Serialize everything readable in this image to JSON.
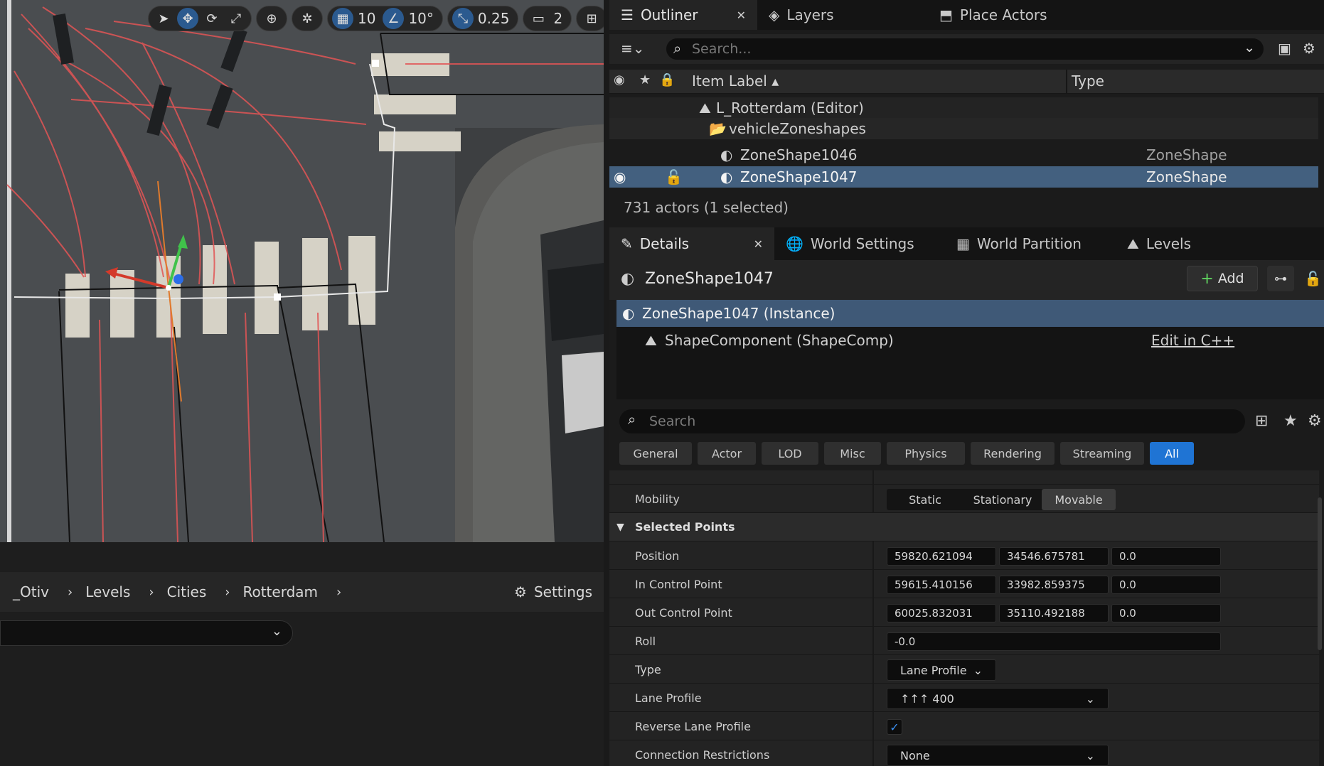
{
  "viewport": {
    "toolbar": {
      "grid_snap": "10",
      "rotation_snap": "10°",
      "scale_snap": "0.25",
      "camera_speed": "2"
    }
  },
  "content_browser": {
    "breadcrumb": [
      "_Otiv",
      "Levels",
      "Cities",
      "Rotterdam"
    ],
    "settings_label": "Settings"
  },
  "outliner": {
    "tabs": [
      {
        "label": "Outliner",
        "icon": "outliner-icon"
      },
      {
        "label": "Layers",
        "icon": "layers-icon"
      },
      {
        "label": "Place Actors",
        "icon": "place-actors-icon"
      }
    ],
    "search_placeholder": "Search...",
    "columns": {
      "label": "Item Label",
      "type": "Type"
    },
    "rows": [
      {
        "label": "L_Rotterdam (Editor)",
        "type": "",
        "icon": "level-icon"
      },
      {
        "label": "vehicleZoneshapes",
        "type": "",
        "icon": "folder-icon"
      },
      {
        "label": "ZoneShape1046",
        "type": "ZoneShape",
        "icon": "actor-icon"
      },
      {
        "label": "ZoneShape1047",
        "type": "ZoneShape",
        "icon": "actor-icon"
      }
    ],
    "status": "731 actors (1 selected)"
  },
  "details": {
    "tabs": [
      {
        "label": "Details",
        "icon": "details-icon"
      },
      {
        "label": "World Settings",
        "icon": "world-settings-icon"
      },
      {
        "label": "World Partition",
        "icon": "world-partition-icon"
      },
      {
        "label": "Levels",
        "icon": "levels-icon"
      }
    ],
    "actor_name": "ZoneShape1047",
    "add_label": "Add",
    "components": [
      {
        "label": "ZoneShape1047 (Instance)"
      },
      {
        "label": "ShapeComponent (ShapeComp)",
        "link": "Edit in C++"
      }
    ],
    "search_placeholder": "Search",
    "filters": [
      "General",
      "Actor",
      "LOD",
      "Misc",
      "Physics",
      "Rendering",
      "Streaming",
      "All"
    ],
    "active_filter": "All",
    "mobility": {
      "label": "Mobility",
      "options": [
        "Static",
        "Stationary",
        "Movable"
      ],
      "selected": "Movable"
    },
    "section": "Selected Points",
    "properties": [
      {
        "label": "Position",
        "x": "59820.621094",
        "y": "34546.675781",
        "z": "0.0"
      },
      {
        "label": "In Control Point",
        "x": "59615.410156",
        "y": "33982.859375",
        "z": "0.0"
      },
      {
        "label": "Out Control Point",
        "x": "60025.832031",
        "y": "35110.492188",
        "z": "0.0"
      }
    ],
    "roll": {
      "label": "Roll",
      "value": "-0.0"
    },
    "type": {
      "label": "Type",
      "value": "Lane Profile"
    },
    "lane_profile": {
      "label": "Lane Profile",
      "value": "↑↑↑ 400"
    },
    "reverse_lane_profile": {
      "label": "Reverse Lane Profile",
      "checked": true
    },
    "connection_restrictions": {
      "label": "Connection Restrictions",
      "value": "None"
    }
  }
}
